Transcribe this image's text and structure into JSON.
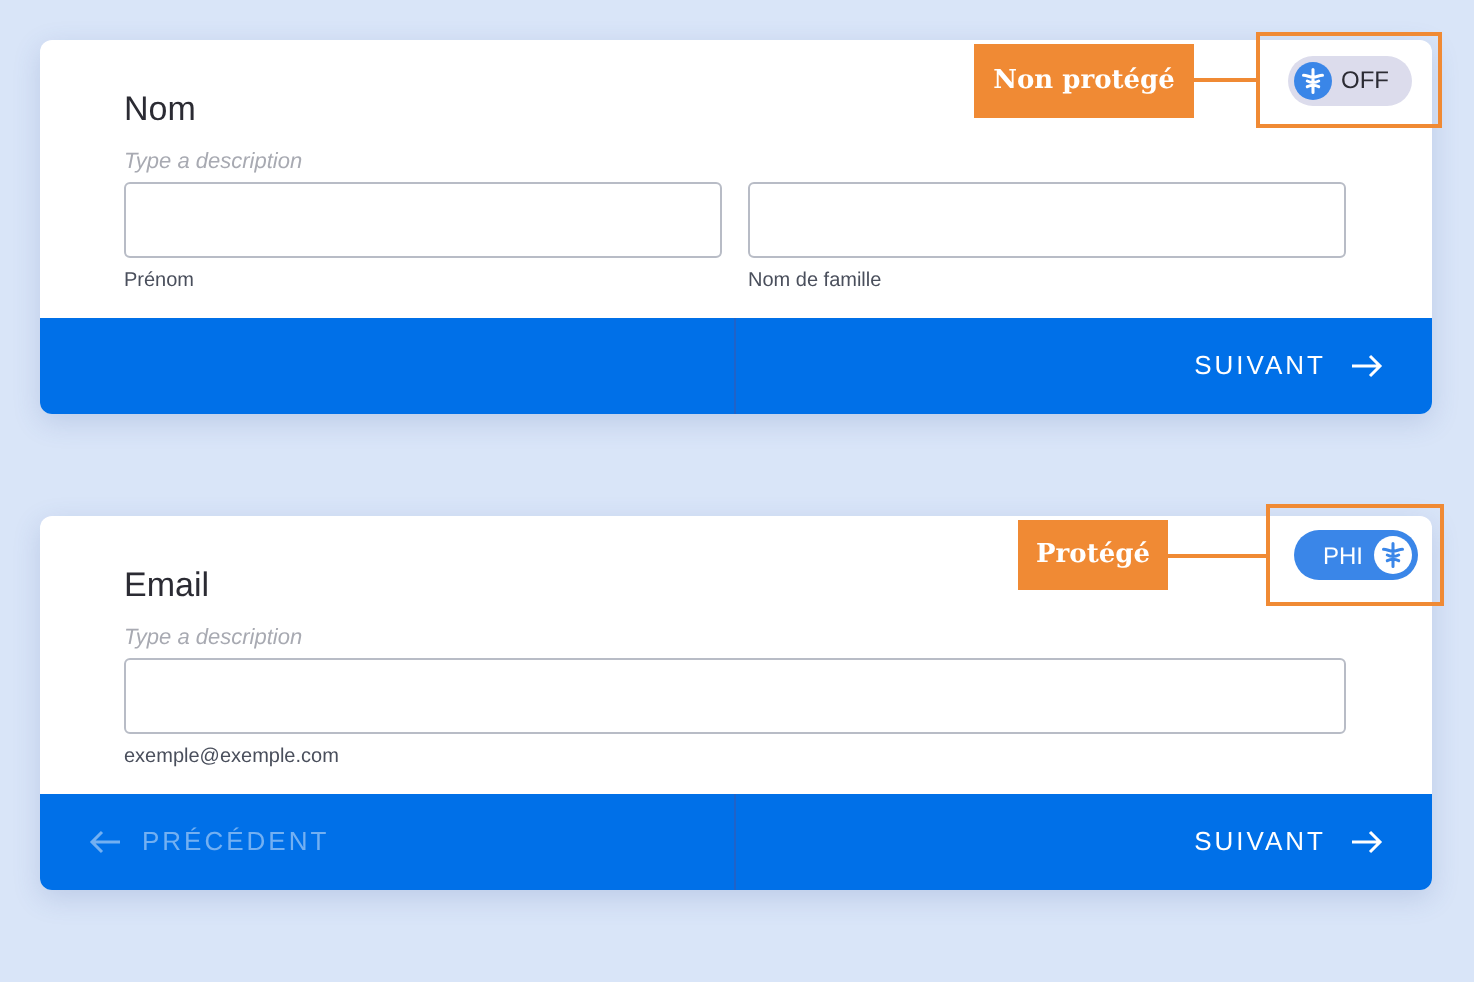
{
  "cards": [
    {
      "title": "Nom",
      "description_placeholder": "Type a description",
      "fields": [
        {
          "sublabel": "Prénom"
        },
        {
          "sublabel": "Nom de famille"
        }
      ],
      "phi_toggle": {
        "on": false,
        "label": "OFF"
      },
      "callout": "Non protégé",
      "next": {
        "label": "SUIVANT"
      }
    },
    {
      "title": "Email",
      "description_placeholder": "Type a description",
      "fields": [
        {
          "sublabel": "exemple@exemple.com"
        }
      ],
      "phi_toggle": {
        "on": true,
        "label": "PHI"
      },
      "callout": "Protégé",
      "previous": {
        "label": "PRÉCÉDENT",
        "disabled": true
      },
      "next": {
        "label": "SUIVANT"
      }
    }
  ]
}
